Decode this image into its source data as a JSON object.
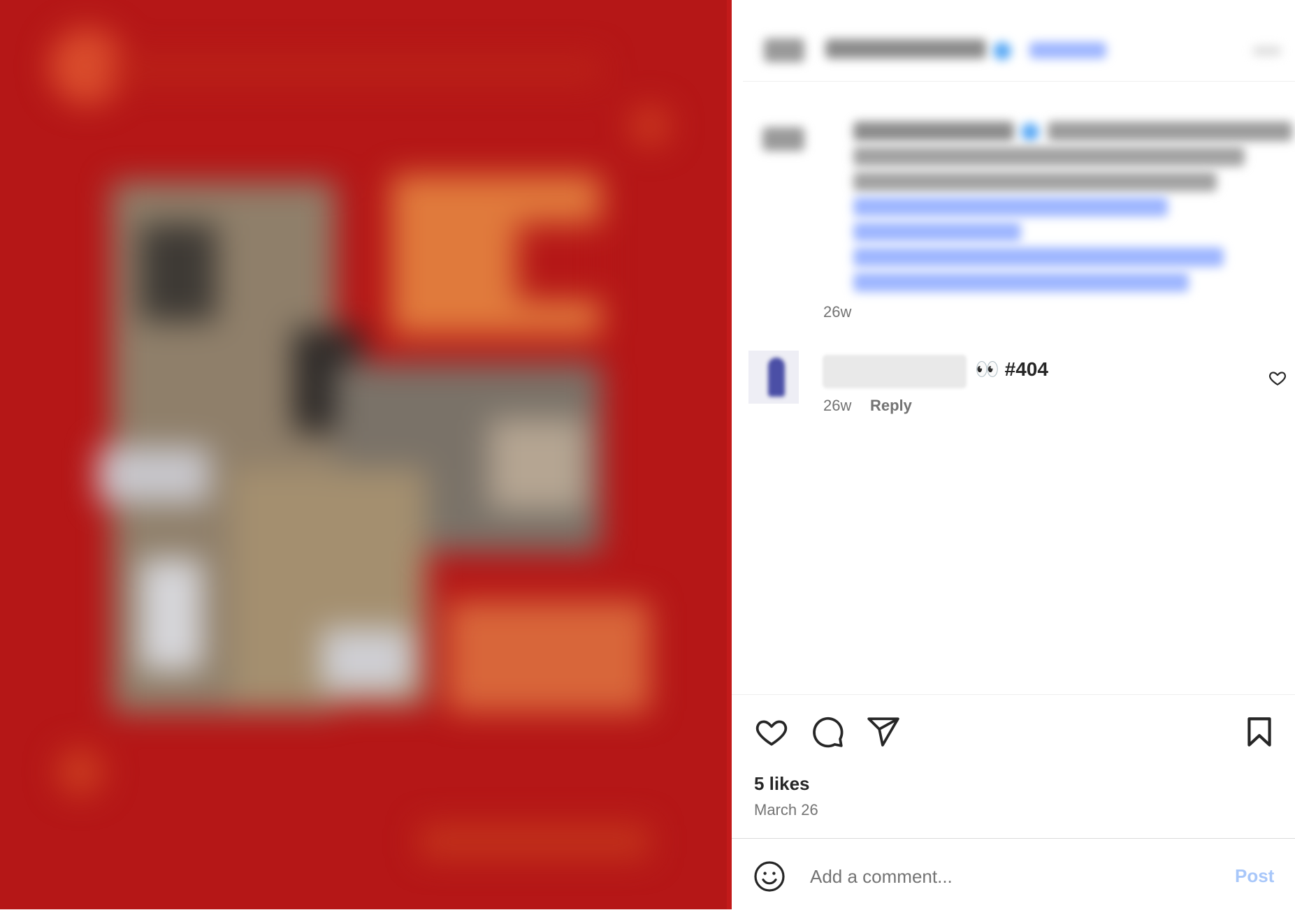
{
  "colors": {
    "media_background": "#b51717",
    "accent_blue": "#0095f6",
    "muted_text": "#737373",
    "post_disabled": "#a8c7fa"
  },
  "media": {
    "description_icon": "blurred-post-image"
  },
  "header": {
    "username": "",
    "follow_label": "",
    "more_icon": "more-options-icon"
  },
  "caption": {
    "time": "26w"
  },
  "comment": {
    "text": "👀 #404",
    "time": "26w",
    "reply_label": "Reply",
    "like_icon": "heart-outline-icon"
  },
  "actions": {
    "like_icon": "heart-outline-icon",
    "comment_icon": "comment-bubble-icon",
    "share_icon": "paper-plane-icon",
    "save_icon": "bookmark-icon",
    "likes_text": "5 likes",
    "date_text": "March 26"
  },
  "add_comment": {
    "emoji_icon": "smiley-icon",
    "placeholder": "Add a comment...",
    "post_label": "Post"
  }
}
